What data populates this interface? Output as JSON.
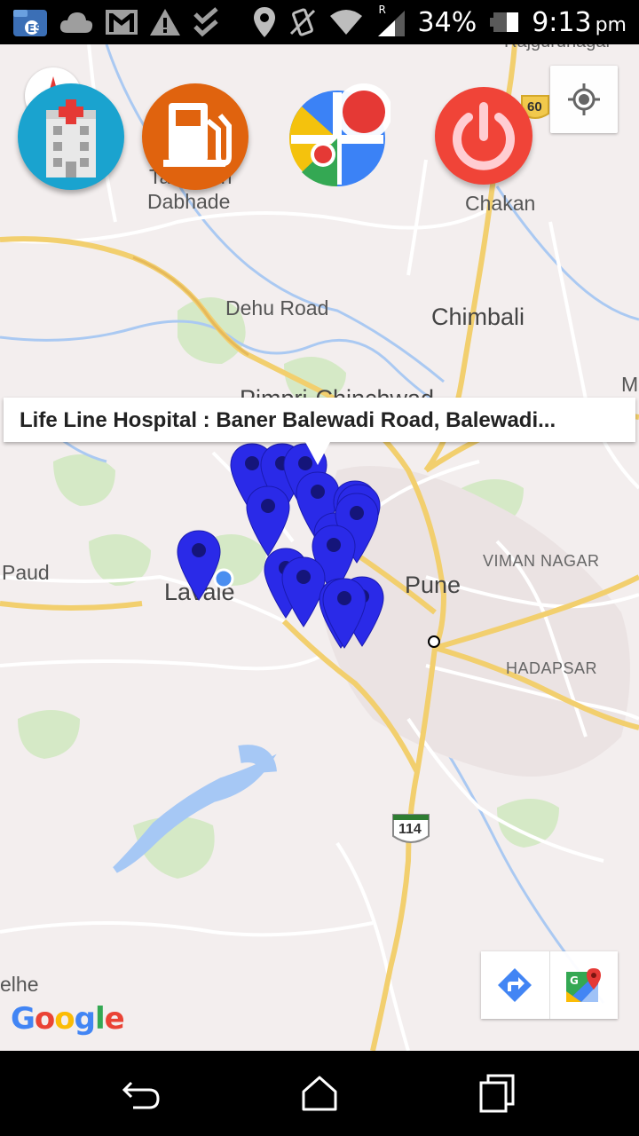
{
  "status_bar": {
    "battery": "34%",
    "time": "9:13",
    "ampm": "pm",
    "roaming": "R",
    "icons": [
      "es-file-icon",
      "cloud-icon",
      "gmail-icon",
      "warning-icon",
      "checklist-icon",
      "location-pin-icon",
      "vibrate-icon",
      "wifi-icon",
      "signal-icon",
      "battery-icon"
    ]
  },
  "actions": {
    "hospital": "hospital-icon",
    "fuel": "fuel-station-icon",
    "places": "map-places-icon",
    "power": "power-icon",
    "locate": "my-location-icon"
  },
  "map": {
    "labels": {
      "rajgurunagar": "Rajgurunagar",
      "dabhade_1": "Talegaon",
      "dabhade_2": "Dabhade",
      "chakan": "Chakan",
      "dehu_road": "Dehu Road",
      "chimbali": "Chimbali",
      "pimpri": "Pimpri-Chinchwad",
      "m": "M",
      "paud": "Paud",
      "lavale": "Lavale",
      "pune": "Pune",
      "viman_nagar": "VIMAN NAGAR",
      "hadapsar": "HADAPSAR",
      "elhe": "elhe",
      "shield_60": "60",
      "shield_114": "114"
    },
    "info_window": {
      "title": "Life Line Hospital : Baner Balewadi Road, Balewadi..."
    },
    "colors": {
      "marker": "#2a2ae8",
      "road": "#f7d57a",
      "water": "#a6c8f5",
      "park": "#cbe6b8"
    }
  },
  "toolbar": {
    "directions": "directions-icon",
    "google_maps": "google-maps-icon"
  },
  "google_logo": {
    "letters": [
      "G",
      "o",
      "o",
      "g",
      "l",
      "e"
    ]
  },
  "nav_bar": {
    "back": "back-icon",
    "home": "home-icon",
    "recents": "recents-icon"
  }
}
